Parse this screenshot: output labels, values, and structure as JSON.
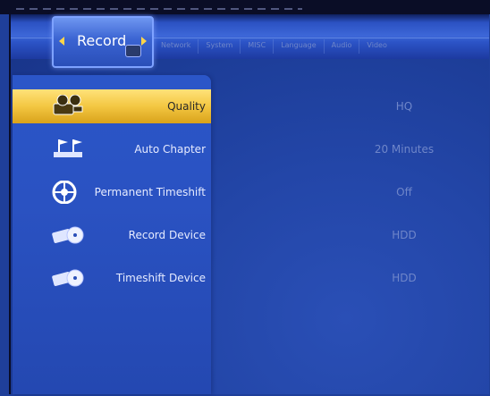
{
  "header": {
    "active_tab": "Record",
    "tabs": [
      "Network",
      "System",
      "MISC",
      "Language",
      "Audio",
      "Video"
    ]
  },
  "settings": [
    {
      "label": "Quality",
      "value": "HQ",
      "icon": "camcorder-icon"
    },
    {
      "label": "Auto Chapter",
      "value": "20 Minutes",
      "icon": "flags-icon"
    },
    {
      "label": "Permanent Timeshift",
      "value": "Off",
      "icon": "timeshift-circle-icon"
    },
    {
      "label": "Record Device",
      "value": "HDD",
      "icon": "disk-icon"
    },
    {
      "label": "Timeshift Device",
      "value": "HDD",
      "icon": "disk-icon"
    }
  ],
  "colors": {
    "selected_highlight": "#f3c742",
    "background": "#1f3f9a",
    "value_text": "#6f86c9"
  }
}
